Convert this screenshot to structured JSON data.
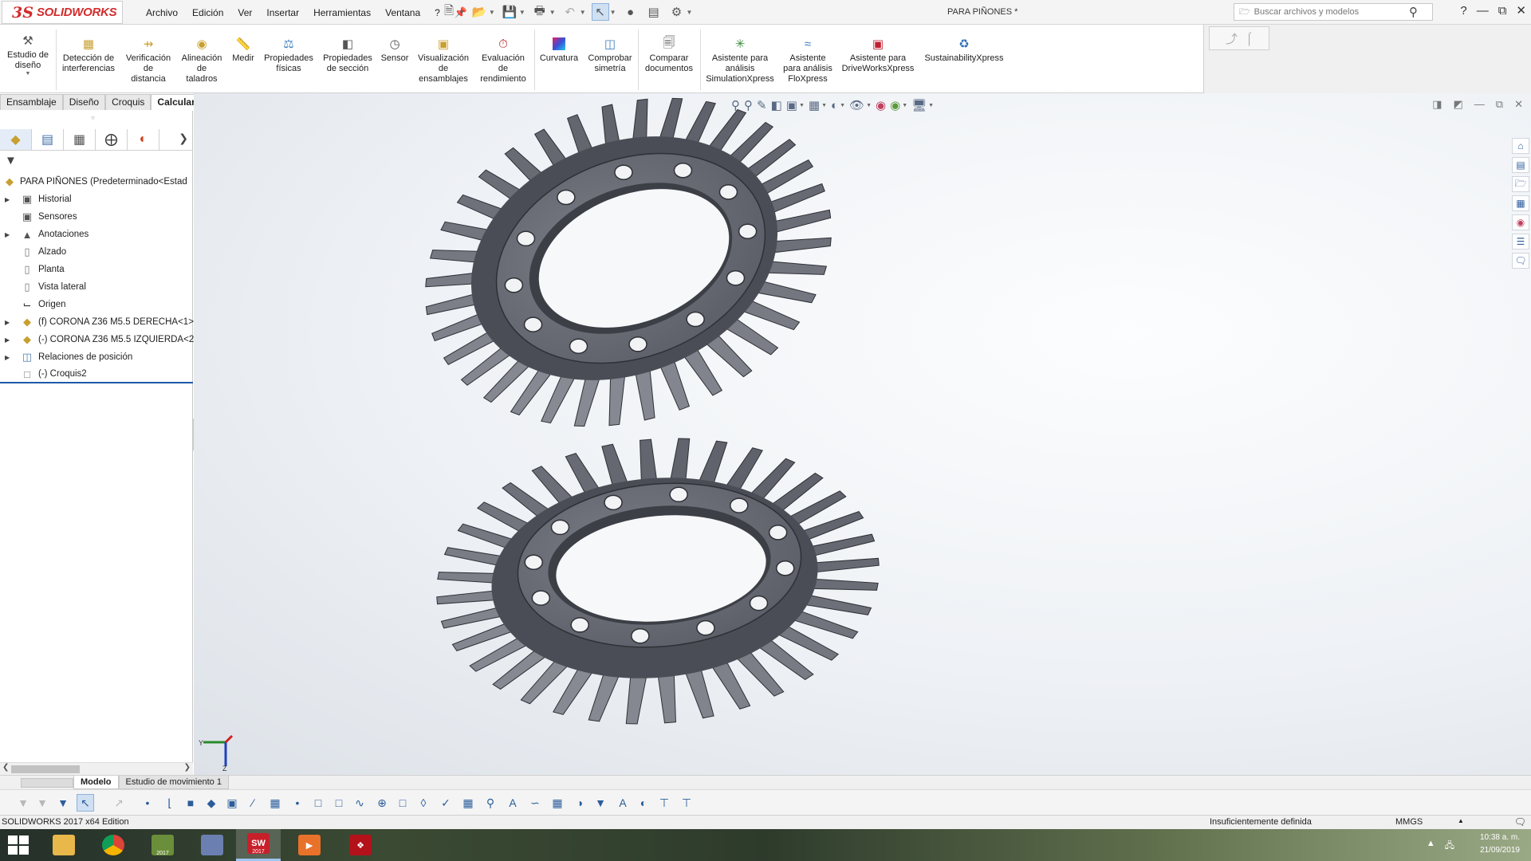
{
  "app": {
    "brand_prefix": "3S",
    "brand_name": "SOLIDWORKS",
    "document_title": "PARA PIÑONES *",
    "edition": "SOLIDWORKS 2017 x64 Edition"
  },
  "menu": [
    "Archivo",
    "Edición",
    "Ver",
    "Insertar",
    "Herramientas",
    "Ventana",
    "?"
  ],
  "search": {
    "placeholder": "Buscar archivos y modelos"
  },
  "ribbon": [
    {
      "label": "Estudio de\ndiseño",
      "icon": "design-study-icon"
    },
    {
      "label": "Detección de\ninterferencias",
      "icon": "interference-detection-icon"
    },
    {
      "label": "Verificación\nde\ndistancia",
      "icon": "clearance-verification-icon"
    },
    {
      "label": "Alineación\nde\ntaladros",
      "icon": "hole-alignment-icon"
    },
    {
      "label": "Medir",
      "icon": "measure-icon"
    },
    {
      "label": "Propiedades\nfísicas",
      "icon": "mass-properties-icon"
    },
    {
      "label": "Propiedades\nde sección",
      "icon": "section-properties-icon"
    },
    {
      "label": "Sensor",
      "icon": "sensor-icon"
    },
    {
      "label": "Visualización\nde\nensamblajes",
      "icon": "assembly-visualization-icon"
    },
    {
      "label": "Evaluación\nde\nrendimiento",
      "icon": "performance-evaluation-icon"
    },
    {
      "label": "Curvatura",
      "icon": "curvature-icon"
    },
    {
      "label": "Comprobar\nsimetría",
      "icon": "symmetry-check-icon"
    },
    {
      "label": "Comparar\ndocumentos",
      "icon": "compare-documents-icon"
    },
    {
      "label": "Asistente para\nanálisis\nSimulationXpress",
      "icon": "simulationxpress-icon"
    },
    {
      "label": "Asistente\npara análisis\nFloXpress",
      "icon": "floxpress-icon"
    },
    {
      "label": "Asistente para\nDriveWorksXpress",
      "icon": "driveworksxpress-icon"
    },
    {
      "label": "SustainabilityXpress",
      "icon": "sustainabilityxpress-icon"
    }
  ],
  "cm_tabs": [
    "Ensamblaje",
    "Diseño",
    "Croquis",
    "Calcular"
  ],
  "cm_active": "Calcular",
  "tree": {
    "root": "PARA PIÑONES  (Predeterminado<Estad",
    "items": [
      {
        "label": "Historial",
        "icon": "history-folder-icon",
        "expandable": true
      },
      {
        "label": "Sensores",
        "icon": "sensors-folder-icon",
        "expandable": false
      },
      {
        "label": "Anotaciones",
        "icon": "annotations-icon",
        "expandable": true
      },
      {
        "label": "Alzado",
        "icon": "plane-icon",
        "expandable": false
      },
      {
        "label": "Planta",
        "icon": "plane-icon",
        "expandable": false
      },
      {
        "label": "Vista lateral",
        "icon": "plane-icon",
        "expandable": false
      },
      {
        "label": "Origen",
        "icon": "origin-icon",
        "expandable": false
      },
      {
        "label": "(f) CORONA Z36 M5.5 DERECHA<1>",
        "icon": "part-icon",
        "expandable": true
      },
      {
        "label": "(-) CORONA Z36 M5.5 IZQUIERDA<2",
        "icon": "part-icon",
        "expandable": true
      },
      {
        "label": "Relaciones de posición",
        "icon": "mates-icon",
        "expandable": true
      },
      {
        "label": "(-) Croquis2",
        "icon": "sketch-icon",
        "expandable": false
      }
    ]
  },
  "bottom_tabs": [
    "Modelo",
    "Estudio de movimiento 1"
  ],
  "status": {
    "state": "Insuficientemente definida",
    "units": "MMGS"
  },
  "clock": {
    "time": "10:38 a. m.",
    "date": "21/09/2019"
  },
  "taskbar_apps": [
    {
      "name": "file-explorer",
      "icon": "folder-icon",
      "color": "#e8b84a",
      "text": ""
    },
    {
      "name": "chrome",
      "icon": "chrome-icon",
      "color": "#db4437",
      "text": ""
    },
    {
      "name": "solidworks-composer",
      "icon": "composer-icon",
      "color": "#6b8e3a",
      "text": "2017"
    },
    {
      "name": "calculator",
      "icon": "calculator-icon",
      "color": "#6b7fb0",
      "text": ""
    },
    {
      "name": "solidworks",
      "icon": "solidworks-icon",
      "color": "#c8202a",
      "text": "2017"
    },
    {
      "name": "media-player",
      "icon": "media-player-icon",
      "color": "#e8722a",
      "text": ""
    },
    {
      "name": "acrobat",
      "icon": "acrobat-icon",
      "color": "#b3121a",
      "text": ""
    }
  ],
  "colors": {
    "brand": "#d22c2c",
    "gear": "#5d6068",
    "gear_face": "#6f727b",
    "selection": "#1d5aa8"
  }
}
